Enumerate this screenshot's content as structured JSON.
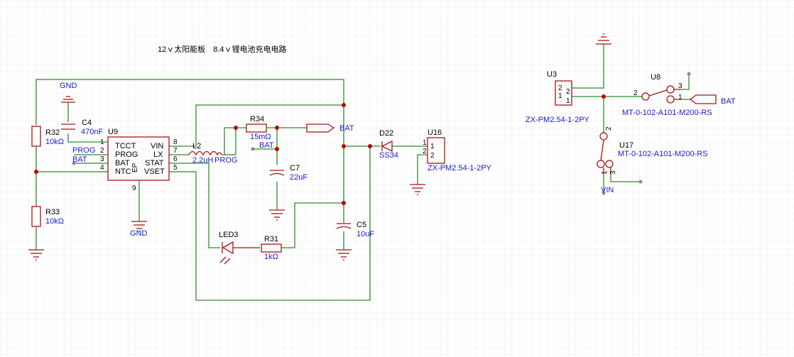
{
  "title": "12ｖ太阳能板　8.4ｖ锂电池充电电路",
  "colors": {
    "wire": "#2e8b2e",
    "part": "#a81414",
    "ref_text": "#000000",
    "value_text": "#1a1ad6",
    "junction": "#c00000",
    "grid": "#e6e6e6"
  },
  "u9": {
    "ref": "U9",
    "pins_left": [
      "TCCT",
      "PROG",
      "BAT",
      "NTC"
    ],
    "pins_right": [
      "VIN",
      "LX",
      "STAT",
      "VSET"
    ],
    "num_left": [
      "1",
      "2",
      "3",
      "4"
    ],
    "num_right": [
      "8",
      "7",
      "6",
      "5"
    ],
    "num_bottom": "9",
    "ep": "EP"
  },
  "c4": {
    "ref": "C4",
    "value": "470nF"
  },
  "r32": {
    "ref": "R32",
    "value": "10kΩ"
  },
  "r33": {
    "ref": "R33",
    "value": "10kΩ"
  },
  "l2": {
    "ref": "L2",
    "value": "2.2uH"
  },
  "r34": {
    "ref": "R34",
    "value": "15mΩ"
  },
  "c7": {
    "ref": "C7",
    "value": "22uF"
  },
  "c5": {
    "ref": "C5",
    "value": "10uF"
  },
  "led3": {
    "ref": "LED3"
  },
  "r31": {
    "ref": "R31",
    "value": "1kΩ"
  },
  "d22": {
    "ref": "D22",
    "value": "SS34"
  },
  "u16": {
    "ref": "U16",
    "value": "ZX-PM2.54-1-2PY",
    "pins": [
      "1",
      "2"
    ]
  },
  "u3": {
    "ref": "U3",
    "value": "ZX-PM2.54-1-2PY",
    "pins": [
      "2",
      "1"
    ],
    "pin_nums": [
      "2",
      "1"
    ]
  },
  "u8": {
    "ref": "U8",
    "value": "MT-0-102-A101-M200-RS",
    "pins": [
      "2",
      "3",
      "1"
    ]
  },
  "u17": {
    "ref": "U17",
    "value": "MT-0-102-A101-M200-RS",
    "pins": [
      "2",
      "1",
      "3"
    ]
  },
  "nets": {
    "gnd": "GND",
    "prog": "PROG",
    "bat": "BAT",
    "vin": "VIN"
  }
}
